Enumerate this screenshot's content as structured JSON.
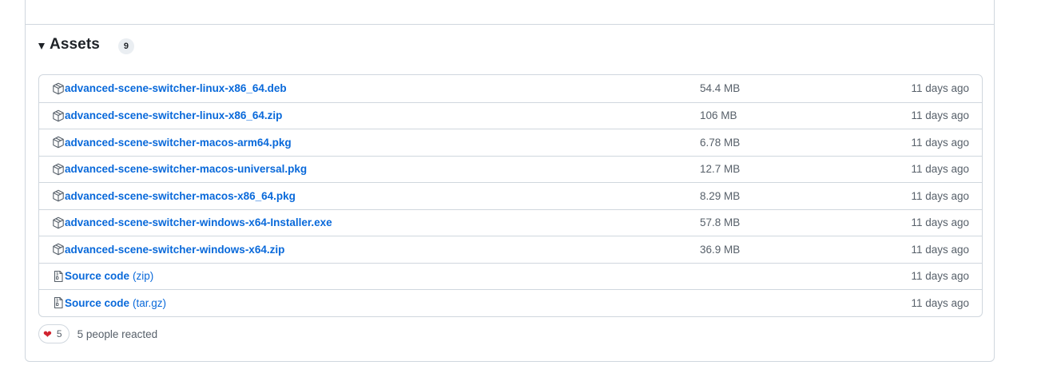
{
  "assets": {
    "title": "Assets",
    "count": "9",
    "items": [
      {
        "icon": "package-icon",
        "name": "advanced-scene-switcher-linux-x86_64.deb",
        "size": "54.4 MB",
        "date": "11 days ago"
      },
      {
        "icon": "package-icon",
        "name": "advanced-scene-switcher-linux-x86_64.zip",
        "size": "106 MB",
        "date": "11 days ago"
      },
      {
        "icon": "package-icon",
        "name": "advanced-scene-switcher-macos-arm64.pkg",
        "size": "6.78 MB",
        "date": "11 days ago"
      },
      {
        "icon": "package-icon",
        "name": "advanced-scene-switcher-macos-universal.pkg",
        "size": "12.7 MB",
        "date": "11 days ago"
      },
      {
        "icon": "package-icon",
        "name": "advanced-scene-switcher-macos-x86_64.pkg",
        "size": "8.29 MB",
        "date": "11 days ago"
      },
      {
        "icon": "package-icon",
        "name": "advanced-scene-switcher-windows-x64-Installer.exe",
        "size": "57.8 MB",
        "date": "11 days ago"
      },
      {
        "icon": "package-icon",
        "name": "advanced-scene-switcher-windows-x64.zip",
        "size": "36.9 MB",
        "date": "11 days ago"
      },
      {
        "icon": "file-zip-icon",
        "name": "Source code",
        "suffix": "(zip)",
        "size": "",
        "date": "11 days ago"
      },
      {
        "icon": "file-zip-icon",
        "name": "Source code",
        "suffix": "(tar.gz)",
        "size": "",
        "date": "11 days ago"
      }
    ]
  },
  "reactions": {
    "emoji": "❤",
    "emoji_icon": "heart-icon",
    "count": "5",
    "summary": "5 people reacted"
  },
  "colors": {
    "link": "#0969da",
    "muted": "#57606a",
    "border": "#d0d7de",
    "heart": "#d1242f"
  }
}
